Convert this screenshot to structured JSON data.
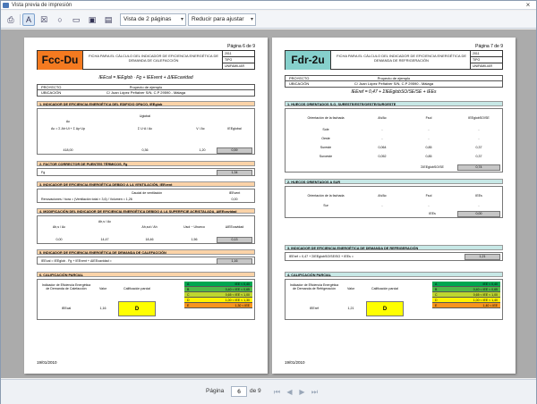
{
  "window": {
    "title": "Vista previa de impresión",
    "close_label": "×"
  },
  "toolbar": {
    "view_mode": "Vista de 2 páginas",
    "fit_mode": "Reducir para ajustar",
    "dropdown_arrow": "▾"
  },
  "footer": {
    "page_label": "Página",
    "current_page": "6",
    "of_label": "de 9",
    "nav_first": "⏮",
    "nav_prev": "◀",
    "nav_next": "▶",
    "nav_last": "⏭"
  },
  "page1": {
    "page_number": "Página 6 de 9",
    "code": "Fcc-Du",
    "title": "FICHA PARA EL CÁLCULO DEL INDICADOR DE EFICIENCIA ENERGÉTICA DE DEMANDA DE CALEFACCIÓN",
    "right1": "2011",
    "right2": "TIPO",
    "right3": "UNIFAMILIAR",
    "formula": "IEEcal = IEEglob ∙ Fg + IEEvent + ΔIEEcavidad",
    "project_label": "PROYECTO",
    "project_value": "Proyecto de ejemplo",
    "location_label": "UBICACIÓN",
    "location_value": "C/ Juan López Peñalver S/N, C.P 29590 - Málaga",
    "s1": "1. INDICADOR DE EFICIENCIA ENERGÉTICA DEL EDIFICIO OPACO, IEEglob",
    "s1_v1": "418,00",
    "s1_v2": "0,36",
    "s1_v3": "1,20",
    "s1_v4": "0,59",
    "s2": "2. FACTOR CORRECTOR DE PUENTES TÉRMICOS, Fg",
    "s2_label": "Fg",
    "s2_v": "1,34",
    "s3": "3. INDICADOR DE EFICIENCIA ENERGÉTICA DEBIDO A LA VENTILACIÓN, IEEvent",
    "s3_head": "Caudal de ventilación",
    "s3_row": "Renovaciones / hora = (Ventilación total × 3,6) / Volumen = 1,26",
    "s3_v": "0,00",
    "s4": "4. MODIFICACIÓN DEL INDICADOR DE EFICIENCIA ENERGÉTICA DEBIDO A LA SUPERFICIE ACRISTALADA, ΔIEEcavidad",
    "s4_v1": "0,00",
    "s4_v2": "14,47",
    "s4_v3": "18,46",
    "s4_v4": "1,56",
    "s4_v5": "0,13",
    "s5": "5. INDICADOR DE EFICIENCIA ENERGÉTICA DE DEMANDA DE CALEFACCIÓN",
    "s5_formula": "IEEcal = IEEglob ∙ Fg + IEEvent + ΔIEEcavidad =",
    "s5_v": "1,16",
    "s6": "6. CALIFICACIÓN PARCIAL",
    "q_indicator": "Indicador de Eficiencia Energética de Demanda de Calefacción",
    "q_value_head": "Valor",
    "q_grade_head": "Calificación parcial",
    "q_row_label": "IEEcal",
    "q_value": "1,16",
    "q_grade": "D",
    "date": "19/01/2010"
  },
  "page2": {
    "page_number": "Página 7 de 9",
    "code": "Fdr-2u",
    "title": "FICHA PARA EL CÁLCULO DEL INDICADOR DE EFICIENCIA ENERGÉTICA DE DEMANDA DE REFRIGERACIÓN",
    "right1": "2011",
    "right2": "TIPO",
    "right3": "UNIFAMILIAR",
    "project_label": "PROYECTO",
    "project_value": "Proyecto de ejemplo",
    "location_label": "UBICACIÓN",
    "location_value": "C/ Juan López Peñalver S/N, C.P 29590 - Málaga",
    "formula": "IEEref = 0,47 + ΣIEEglobSO/SE/SE + IEEs",
    "s1": "1. HUECOS ORIENTADOS S-O, SURESTE/ESTE/OESTE/SUROESTE",
    "t1_h1": "Orientación de la fachada",
    "t1_h2": "Ah/Ac",
    "t1_h3": "Fsol",
    "t1_h4": "IEEglobSO/SE",
    "t1_rows": [
      [
        "Sole",
        "-",
        "-",
        "-"
      ],
      [
        "Oeste",
        "-",
        "-",
        "-"
      ],
      [
        "Sureste",
        "0,064",
        "0,85",
        "0,37"
      ],
      [
        "Suroeste",
        "0,052",
        "0,85",
        "0,37"
      ]
    ],
    "t1_total_label": "ΣIEEglobSO/SE",
    "t1_total": "0,74",
    "s2": "2. HUECOS ORIENTADOS A SUR",
    "t2_h1": "Orientación de la fachada",
    "t2_h2": "Ah/Ac",
    "t2_h3": "Fsol",
    "t2_h4": "IEEs",
    "t2_row": [
      "Sur",
      "-",
      "-",
      "-"
    ],
    "t2_total_label": "IEEs",
    "t2_total": "0,00",
    "s3": "3. INDICADOR DE EFICIENCIA ENERGÉTICA DE DEMANDA DE REFRIGERACIÓN",
    "s3_formula": "IEEref = 0,47 + ΣIEEglobSO/SE/SO + IEEs =",
    "s3_v": "1,21",
    "s4": "4. CALIFICACIÓN PARCIAL",
    "q_indicator": "Indicador de Eficiencia Energética de Demanda de Refrigeración",
    "q_value_head": "Valor",
    "q_grade_head": "Calificación parcial",
    "q_row_label": "IEEref",
    "q_value": "1,21",
    "q_grade": "D",
    "date": "19/01/2010"
  },
  "scale1": [
    {
      "grade": "A",
      "range": "IEE < 0,40",
      "color": "#00a651"
    },
    {
      "grade": "B",
      "range": "0,40 < IEE < 0,65",
      "color": "#50b848"
    },
    {
      "grade": "C",
      "range": "0,65 < IEE < 1,00",
      "color": "#bed630"
    },
    {
      "grade": "D",
      "range": "1,00 < IEE < 1,30",
      "color": "#fff200"
    },
    {
      "grade": "E",
      "range": "1,30 < IEE",
      "color": "#f7941d"
    }
  ],
  "scale2": [
    {
      "grade": "A",
      "range": "IEE < 0,40",
      "color": "#00a651"
    },
    {
      "grade": "B",
      "range": "0,40 < IEE < 0,65",
      "color": "#50b848"
    },
    {
      "grade": "C",
      "range": "0,65 < IEE < 1,00",
      "color": "#bed630"
    },
    {
      "grade": "D",
      "range": "1,00 < IEE < 1,40",
      "color": "#fff200"
    },
    {
      "grade": "E",
      "range": "1,40 < IEE",
      "color": "#f7941d"
    }
  ]
}
